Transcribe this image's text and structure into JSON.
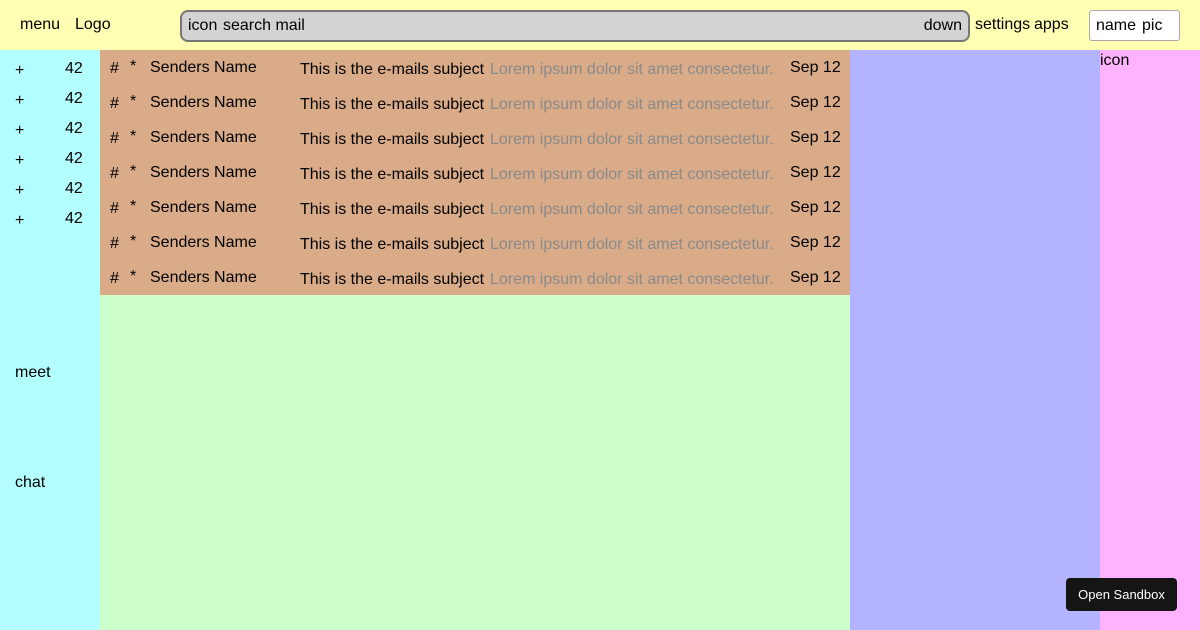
{
  "header": {
    "menu": "menu",
    "logo": "Logo",
    "search": {
      "icon": "icon",
      "placeholder": "search mail",
      "dropdown": "down"
    },
    "settings": "settings",
    "apps": "apps",
    "profile": {
      "name": "name",
      "pic": "pic"
    }
  },
  "sidebar": {
    "items": [
      {
        "icon": "+",
        "count": "42"
      },
      {
        "icon": "+",
        "count": "42"
      },
      {
        "icon": "+",
        "count": "42"
      },
      {
        "icon": "+",
        "count": "42"
      },
      {
        "icon": "+",
        "count": "42"
      },
      {
        "icon": "+",
        "count": "42"
      }
    ],
    "meet": "meet",
    "chat": "chat"
  },
  "emails": [
    {
      "hash": "#",
      "star": "*",
      "sender": "Senders Name",
      "subject": "This is the e-mails subject",
      "preview": "Lorem ipsum dolor sit amet consectetur.",
      "date": "Sep 12"
    },
    {
      "hash": "#",
      "star": "*",
      "sender": "Senders Name",
      "subject": "This is the e-mails subject",
      "preview": "Lorem ipsum dolor sit amet consectetur.",
      "date": "Sep 12"
    },
    {
      "hash": "#",
      "star": "*",
      "sender": "Senders Name",
      "subject": "This is the e-mails subject",
      "preview": "Lorem ipsum dolor sit amet consectetur.",
      "date": "Sep 12"
    },
    {
      "hash": "#",
      "star": "*",
      "sender": "Senders Name",
      "subject": "This is the e-mails subject",
      "preview": "Lorem ipsum dolor sit amet consectetur.",
      "date": "Sep 12"
    },
    {
      "hash": "#",
      "star": "*",
      "sender": "Senders Name",
      "subject": "This is the e-mails subject",
      "preview": "Lorem ipsum dolor sit amet consectetur.",
      "date": "Sep 12"
    },
    {
      "hash": "#",
      "star": "*",
      "sender": "Senders Name",
      "subject": "This is the e-mails subject",
      "preview": "Lorem ipsum dolor sit amet consectetur.",
      "date": "Sep 12"
    },
    {
      "hash": "#",
      "star": "*",
      "sender": "Senders Name",
      "subject": "This is the e-mails subject",
      "preview": "Lorem ipsum dolor sit amet consectetur.",
      "date": "Sep 12"
    }
  ],
  "rail": {
    "icon": "icon"
  },
  "sandbox_button": "Open Sandbox",
  "colors": {
    "header_bg": "#ffffb3",
    "sidebar_bg": "#b3ffff",
    "main_bg": "#ccffcc",
    "maillist_bg": "#d9ab88",
    "panel_bg": "#b3b3ff",
    "rail_bg": "#ffb3ff",
    "search_bg": "#d3d3d3",
    "preview_text": "#8a8a8a"
  }
}
